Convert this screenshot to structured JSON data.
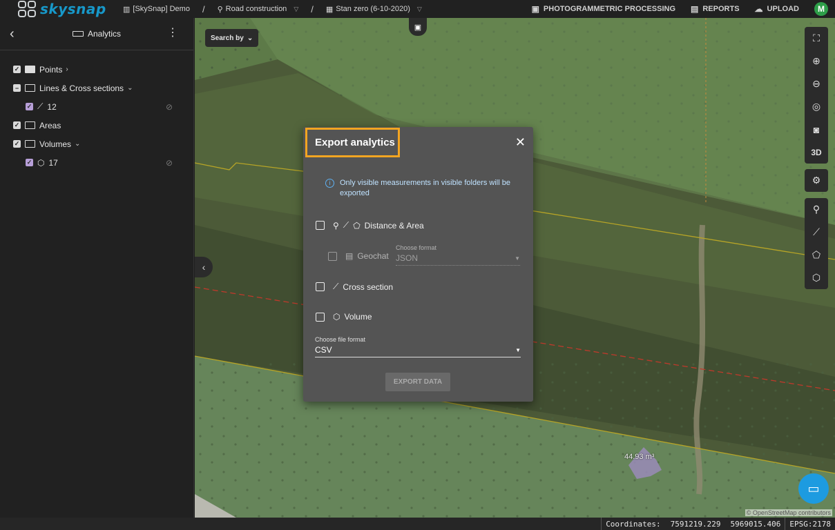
{
  "header": {
    "logo_text": "skysnap",
    "org": "[SkySnap] Demo",
    "project": "Road construction",
    "stage": "Stan zero (6-10-2020)",
    "actions": [
      {
        "label": "PHOTOGRAMMETRIC PROCESSING",
        "icon": "image-plus-icon"
      },
      {
        "label": "REPORTS",
        "icon": "report-plus-icon"
      },
      {
        "label": "UPLOAD",
        "icon": "cloud-upload-icon"
      }
    ],
    "avatar_initial": "M",
    "avatar_color": "#2e9e49",
    "logo_color": "#1798c9"
  },
  "sidebar": {
    "title": "Analytics",
    "items": [
      {
        "label": "Points",
        "checked": true,
        "type": "folder"
      },
      {
        "label": "Lines & Cross sections",
        "checked": "partial",
        "type": "folder"
      },
      {
        "label": "12",
        "checked": true,
        "type": "line-measurement"
      },
      {
        "label": "Areas",
        "checked": true,
        "type": "folder"
      },
      {
        "label": "Volumes",
        "checked": true,
        "type": "folder"
      },
      {
        "label": "17",
        "checked": true,
        "type": "volume-measurement"
      }
    ]
  },
  "map": {
    "search_by": "Search by",
    "volume_label": "44.93 m³",
    "attribution": "© OpenStreetMap contributors",
    "toolbar_3d": "3D"
  },
  "dialog": {
    "title": "Export analytics",
    "info": "Only visible measurements in visible folders will be exported",
    "options": {
      "distance_area": "Distance & Area",
      "geochat": "Geochat",
      "cross_section": "Cross section",
      "volume": "Volume"
    },
    "geochat_format": {
      "label": "Choose format",
      "value": "JSON"
    },
    "file_format": {
      "label": "Choose file format",
      "value": "CSV"
    },
    "export_button": "EXPORT DATA",
    "highlight_color": "#f3a521"
  },
  "status": {
    "coordinates_label": "Coordinates:",
    "x": "7591219.229",
    "y": "5969015.406",
    "epsg": "EPSG:2178"
  }
}
